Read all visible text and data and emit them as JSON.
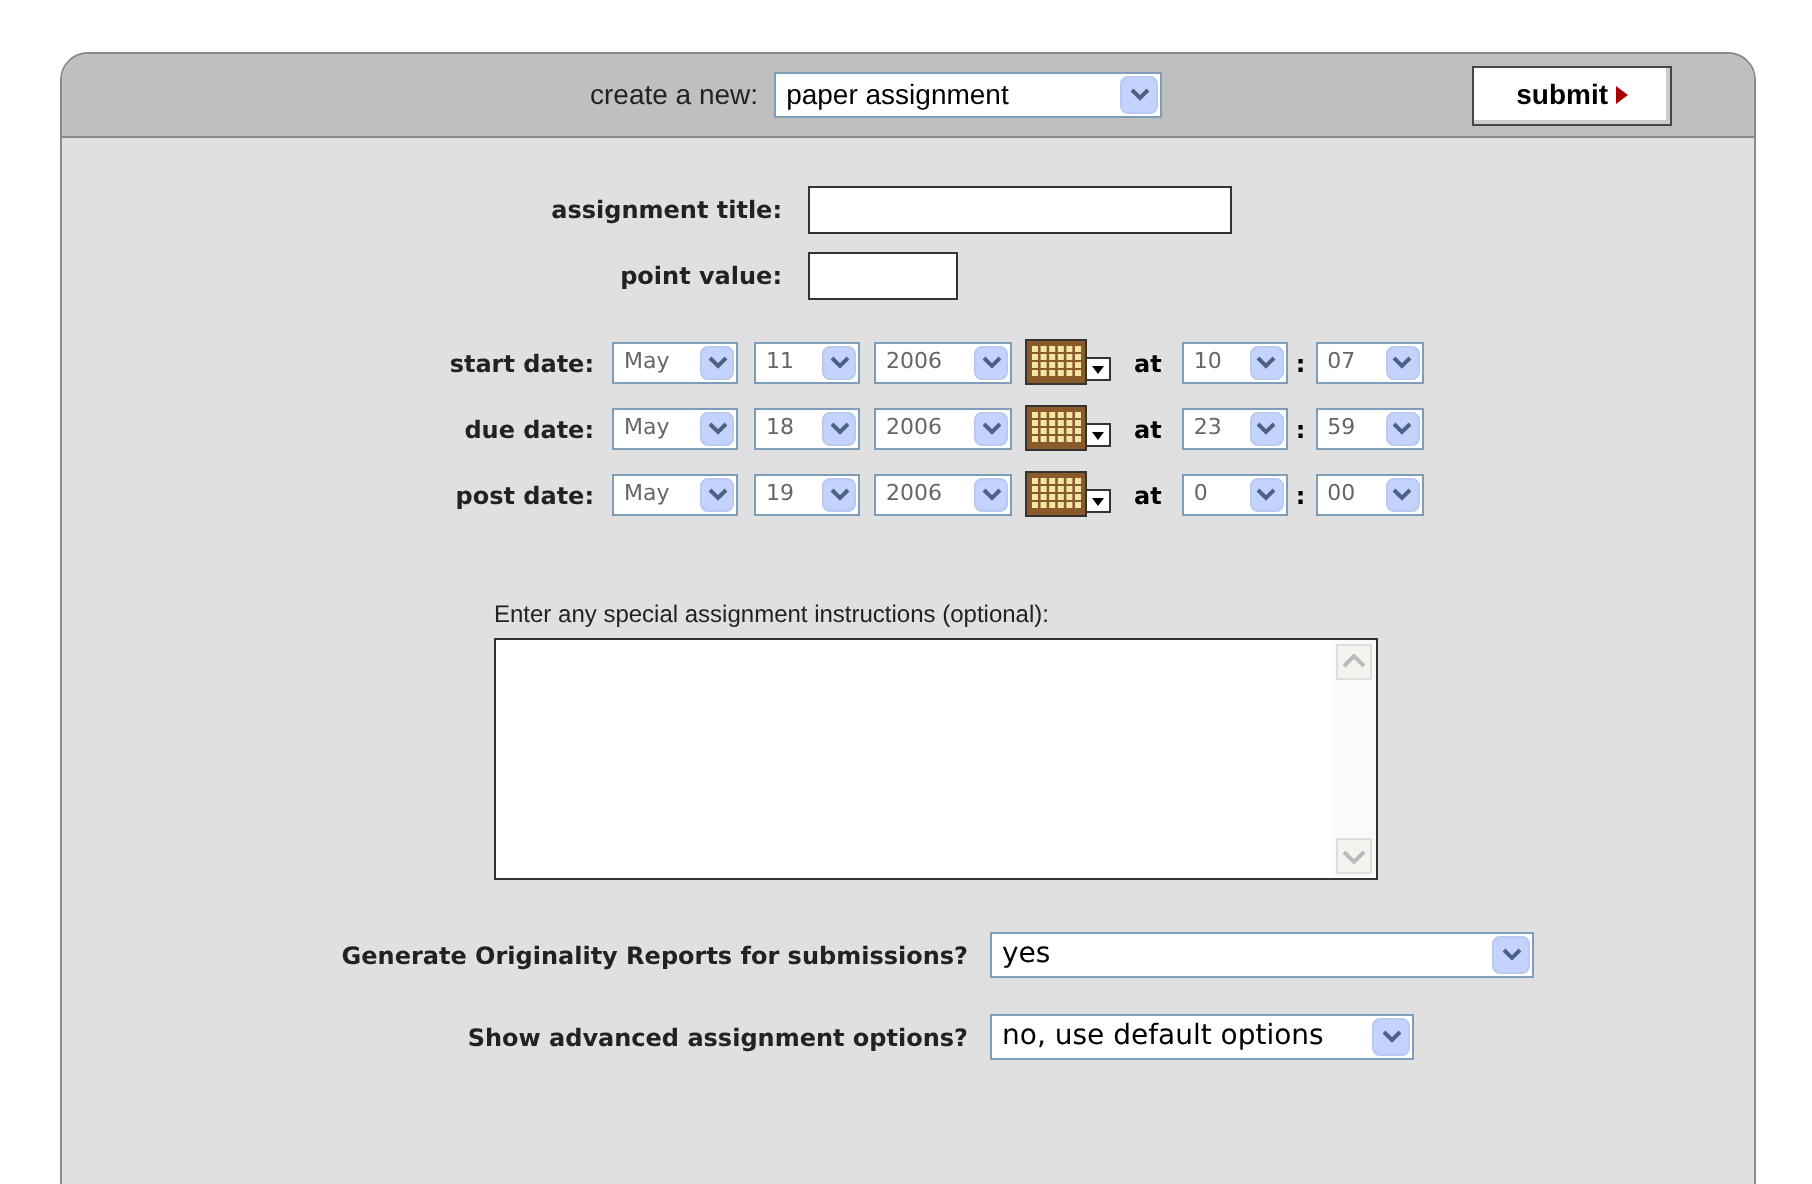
{
  "header": {
    "label": "create a new:",
    "type_select": "paper assignment",
    "submit": "submit"
  },
  "title_field": {
    "label": "assignment title:"
  },
  "points_field": {
    "label": "point value:"
  },
  "dates": [
    {
      "label": "start date:",
      "month": "May",
      "day": "11",
      "year": "2006",
      "at": "at",
      "hour": "10",
      "sep": ":",
      "minute": "07"
    },
    {
      "label": "due date:",
      "month": "May",
      "day": "18",
      "year": "2006",
      "at": "at",
      "hour": "23",
      "sep": ":",
      "minute": "59"
    },
    {
      "label": "post date:",
      "month": "May",
      "day": "19",
      "year": "2006",
      "at": "at",
      "hour": "0",
      "sep": ":",
      "minute": "00"
    }
  ],
  "instructions": {
    "label": "Enter any special assignment instructions (optional):"
  },
  "options": [
    {
      "label": "Generate Originality Reports for submissions?",
      "value": "yes",
      "wide": true
    },
    {
      "label": "Show advanced assignment options?",
      "value": "no, use default options",
      "wide": false
    }
  ]
}
